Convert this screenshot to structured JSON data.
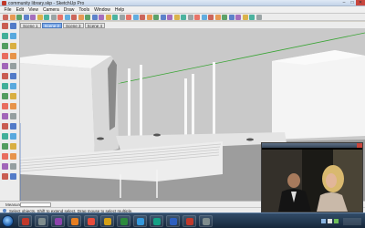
{
  "window": {
    "title": "community library.skp - SketchUp Pro",
    "controls": {
      "minimize": "–",
      "maximize": "□",
      "close": "✕"
    }
  },
  "menu": [
    "File",
    "Edit",
    "View",
    "Camera",
    "Draw",
    "Tools",
    "Window",
    "Help"
  ],
  "tabs": [
    {
      "label": "Scene 1",
      "active": false
    },
    {
      "label": "Scene 2",
      "active": true
    },
    {
      "label": "Scene 3",
      "active": false
    },
    {
      "label": "Scene 4",
      "active": false
    }
  ],
  "measurements": {
    "label": "Measurements",
    "value": ""
  },
  "status": {
    "text": "Select objects. Shift to extend select. Drag mouse to select multiple."
  },
  "colors": {
    "sky": "#c9c9c9",
    "ground": "#9a9a9a",
    "building_white": "#f4f4f4",
    "axis_green": "#3aa535",
    "axis_red": "#c0392b",
    "axis_blue": "#2d5fbf",
    "active_tab": "#7aa7e6",
    "taskbar": "#1f3248"
  },
  "toolbar_icons": [
    "select-icon",
    "eraser-icon",
    "paint-icon",
    "line-icon",
    "arc-icon",
    "shape-icon",
    "pushpull-icon",
    "move-icon",
    "rotate-icon",
    "scale-icon",
    "offset-icon",
    "tape-icon",
    "text-icon",
    "axes-icon",
    "orbit-icon",
    "pan-icon",
    "zoom-icon",
    "zoom-extents-icon",
    "component-icon",
    "layers-icon",
    "shadow-icon",
    "fog-icon",
    "section-icon",
    "xray-icon",
    "wireframe-icon",
    "hiddenline-icon",
    "shaded-icon",
    "textured-icon",
    "monochrome-icon",
    "iso-icon",
    "top-icon",
    "front-icon",
    "right-icon",
    "back-icon",
    "left-icon",
    "walk-icon",
    "look-icon",
    "position-camera-icon"
  ],
  "left_tools": [
    "select-icon",
    "component-icon",
    "paint-icon",
    "eraser-icon",
    "rectangle-icon",
    "line-icon",
    "circle-icon",
    "arc-icon",
    "polygon-icon",
    "freehand-icon",
    "move-icon",
    "pushpull-icon",
    "rotate-icon",
    "followme-icon",
    "scale-icon",
    "offset-icon",
    "tape-icon",
    "dimension-icon",
    "protractor-icon",
    "text-icon",
    "axes-icon",
    "3dtext-icon",
    "orbit-icon",
    "pan-icon",
    "zoom-icon",
    "zoom-window-icon",
    "zoom-extents-icon",
    "previous-icon",
    "position-camera-icon",
    "walk-icon",
    "look-icon",
    "section-icon"
  ],
  "taskbar_icons": [
    "internet-explorer-icon",
    "explorer-folder-icon",
    "media-player-icon",
    "skype-icon",
    "firefox-icon",
    "word-icon",
    "paint-icon",
    "sketchup-icon",
    "vlc-icon",
    "photoshop-icon",
    "media-icon",
    "web-icon"
  ]
}
